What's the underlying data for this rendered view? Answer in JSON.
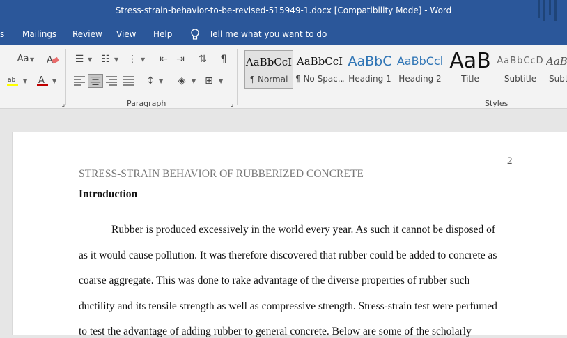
{
  "window": {
    "title": "Stress-strain-behavior-to-be-revised-515949-1.docx [Compatibility Mode]  -  Word"
  },
  "tabs": [
    {
      "label": "s"
    },
    {
      "label": "Mailings"
    },
    {
      "label": "Review"
    },
    {
      "label": "View"
    },
    {
      "label": "Help"
    },
    {
      "label": "Tell me what you want to do"
    }
  ],
  "ribbon": {
    "font_size_label": "Aa",
    "paragraph_label": "Paragraph",
    "styles_label": "Styles",
    "styles": [
      {
        "sample": "AaBbCcI",
        "name": "¶ Normal"
      },
      {
        "sample": "AaBbCcI",
        "name": "¶ No Spac..."
      },
      {
        "sample": "AaBbC",
        "name": "Heading 1"
      },
      {
        "sample": "AaBbCcl",
        "name": "Heading 2"
      },
      {
        "sample": "AaB",
        "name": "Title"
      },
      {
        "sample": "AaBbCcD",
        "name": "Subtitle"
      },
      {
        "sample": "AaB",
        "name": "Subtl"
      }
    ]
  },
  "document": {
    "page_number": "2",
    "running_header": "STRESS-STRAIN BEHAVIOR OF RUBBERIZED CONCRETE",
    "heading": "Introduction",
    "lines": [
      "Rubber is produced excessively in the world every year. As such it cannot be disposed of",
      "as it would cause pollution. It was therefore discovered that rubber could be added to concrete as",
      "coarse aggregate. This was done to rake advantage of the diverse properties of rubber such",
      "ductility and its tensile strength as well as compressive strength. Stress-strain test were perfumed",
      "to test the advantage of adding rubber to general concrete. Below are some of the scholarly"
    ]
  },
  "colors": {
    "title_bar": "#2b579a",
    "ribbon_bg": "#f3f3f3",
    "font_color_red": "#c00000",
    "highlight_yellow": "#ffff00",
    "heading_blue": "#2e74b5"
  }
}
